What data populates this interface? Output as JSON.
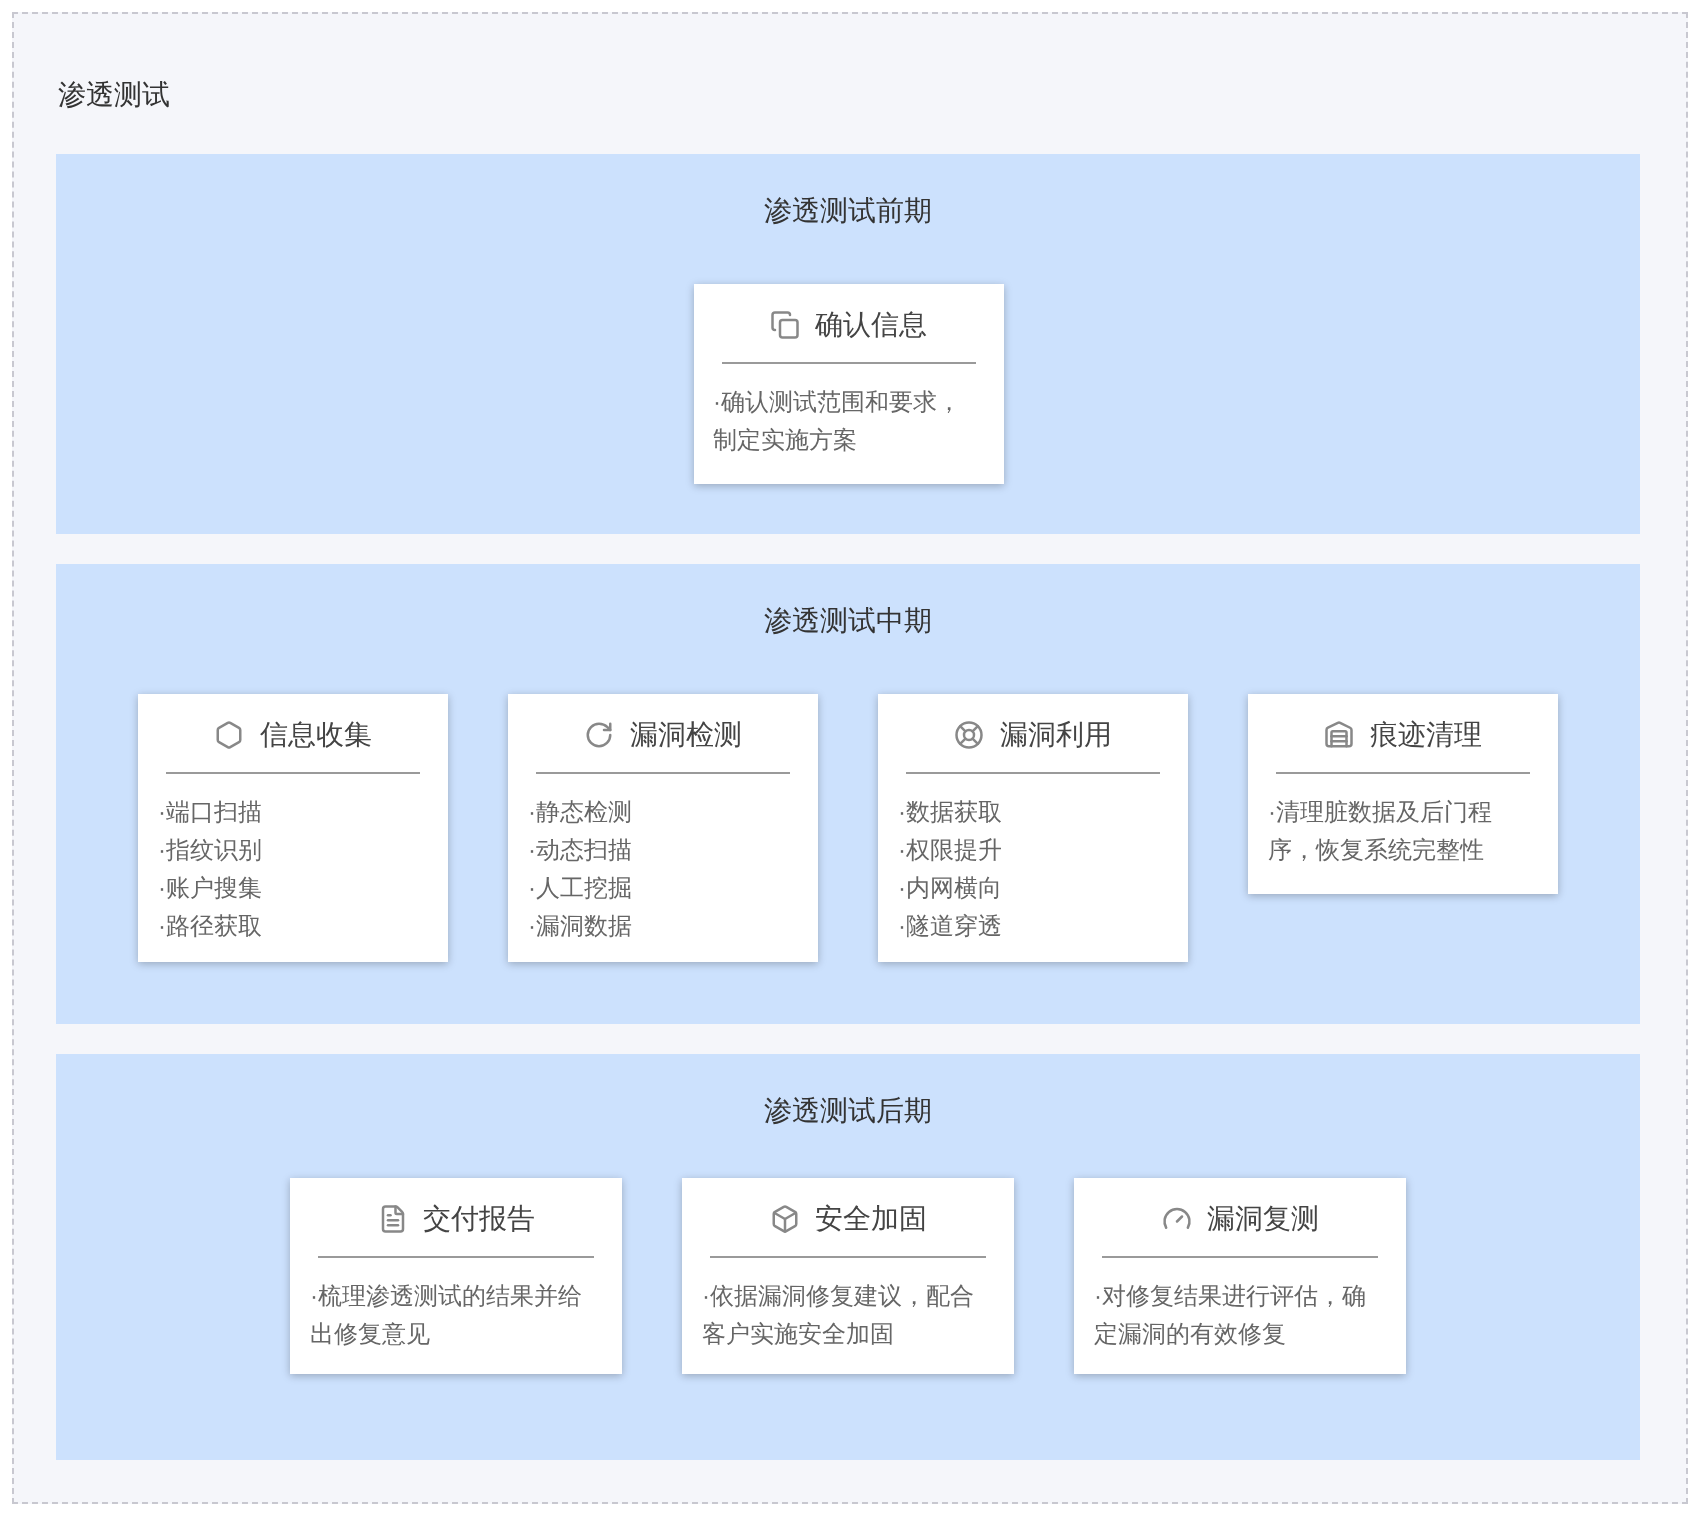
{
  "title": "渗透测试",
  "phases": [
    {
      "title": "渗透测试前期",
      "cards": [
        {
          "title": "确认信息",
          "kind": "text",
          "description": "·确认测试范围和要求，制定实施方案"
        }
      ]
    },
    {
      "title": "渗透测试中期",
      "cards": [
        {
          "title": "信息收集",
          "kind": "list",
          "items": [
            "·端口扫描",
            "·指纹识别",
            "·账户搜集",
            "·路径获取"
          ]
        },
        {
          "title": "漏洞检测",
          "kind": "list",
          "items": [
            "·静态检测",
            "·动态扫描",
            "·人工挖掘",
            "·漏洞数据"
          ]
        },
        {
          "title": "漏洞利用",
          "kind": "list",
          "items": [
            "·数据获取",
            "·权限提升",
            "·内网横向",
            "·隧道穿透"
          ]
        },
        {
          "title": "痕迹清理",
          "kind": "text",
          "description": "·清理脏数据及后门程序，恢复系统完整性"
        }
      ]
    },
    {
      "title": "渗透测试后期",
      "cards": [
        {
          "title": "交付报告",
          "kind": "text",
          "description": "·梳理渗透测试的结果并给出修复意见"
        },
        {
          "title": "安全加固",
          "kind": "text",
          "description": "·依据漏洞修复建议，配合客户实施安全加固"
        },
        {
          "title": "漏洞复测",
          "kind": "text",
          "description": "·对修复结果进行评估，确定漏洞的有效修复"
        }
      ]
    }
  ]
}
